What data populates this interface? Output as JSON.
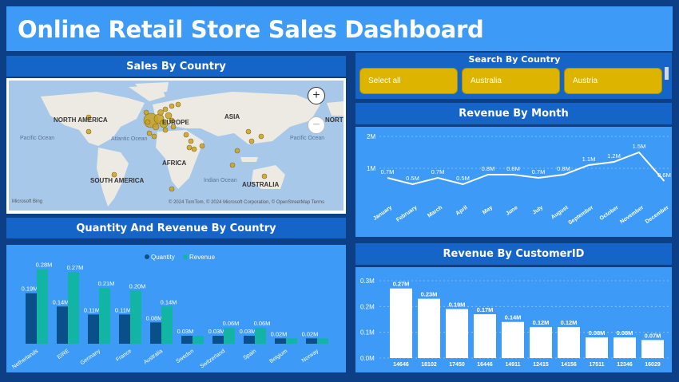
{
  "title": "Online Retail Store Sales Dashboard",
  "panels": {
    "sales_by_country": "Sales By Country",
    "qty_rev_country": "Quantity And Revenue By Country",
    "search_country": "Search By Country",
    "revenue_month": "Revenue By Month",
    "revenue_customer": "Revenue By CustomerID"
  },
  "slicer": {
    "items": [
      "Select all",
      "Australia",
      "Austria"
    ]
  },
  "map": {
    "labels": {
      "north_america": "NORTH AMERICA",
      "europe": "EUROPE",
      "asia": "ASIA",
      "africa": "AFRICA",
      "south_america": "SOUTH AMERICA",
      "australia": "AUSTRALIA",
      "north_cut": "NORTI",
      "pacific_left": "Pacific Ocean",
      "atlantic": "Atlantic Ocean",
      "indian": "Indian Ocean",
      "pacific_right": "Pacific Ocean"
    },
    "zoom_in": "+",
    "zoom_out": "−",
    "copyright": "© 2024 TomTom, © 2024 Microsoft Corporation, © OpenStreetMap  Terms",
    "logo": "Microsoft Bing"
  },
  "colors": {
    "background": "#0d3f86",
    "panel": "#3d9bf7",
    "header": "#1565c8",
    "quantity": "#0b4f8a",
    "revenue": "#12b5a4",
    "slicer": "#ddb400",
    "bubble": "#c9a227"
  },
  "chart_data": [
    {
      "type": "bar",
      "title": "Quantity And Revenue By Country",
      "categories": [
        "Netherlands",
        "EIRE",
        "Germany",
        "France",
        "Australia",
        "Sweden",
        "Switzerland",
        "Spain",
        "Belgium",
        "Norway"
      ],
      "series": [
        {
          "name": "Quantity",
          "values": [
            0.19,
            0.14,
            0.11,
            0.11,
            0.08,
            0.03,
            0.03,
            0.03,
            0.02,
            0.02
          ],
          "labels": [
            "0.19M",
            "0.14M",
            "0.11M",
            "0.11M",
            "0.08M",
            "0.03M",
            "0.03M",
            "0.03M",
            "0.02M",
            "0.02M"
          ]
        },
        {
          "name": "Revenue",
          "values": [
            0.28,
            0.27,
            0.21,
            0.2,
            0.14,
            0.03,
            0.06,
            0.06,
            0.02,
            0.02
          ],
          "labels": [
            "0.28M",
            "0.27M",
            "0.21M",
            "0.20M",
            "0.14M",
            "",
            "0.06M",
            "0.06M",
            "",
            ""
          ]
        }
      ],
      "legend": "top-center"
    },
    {
      "type": "line",
      "title": "Revenue By Month",
      "categories": [
        "January",
        "February",
        "March",
        "April",
        "May",
        "June",
        "July",
        "August",
        "September",
        "October",
        "November",
        "December"
      ],
      "values": [
        0.7,
        0.5,
        0.7,
        0.5,
        0.8,
        0.8,
        0.7,
        0.8,
        1.1,
        1.2,
        1.5,
        0.6
      ],
      "labels": [
        "0.7M",
        "0.5M",
        "0.7M",
        "0.5M",
        "0.8M",
        "0.8M",
        "0.7M",
        "0.8M",
        "1.1M",
        "1.2M",
        "1.5M",
        "0.6M"
      ],
      "yticks": [
        "1M",
        "2M"
      ],
      "ylim": [
        0,
        2
      ]
    },
    {
      "type": "bar",
      "title": "Revenue By CustomerID",
      "categories": [
        "14646",
        "18102",
        "17450",
        "16446",
        "14911",
        "12415",
        "14156",
        "17511",
        "12346",
        "16029"
      ],
      "values": [
        0.27,
        0.23,
        0.19,
        0.17,
        0.14,
        0.12,
        0.12,
        0.08,
        0.08,
        0.07
      ],
      "labels": [
        "0.27M",
        "0.23M",
        "0.19M",
        "0.17M",
        "0.14M",
        "0.12M",
        "0.12M",
        "0.08M",
        "0.08M",
        "0.07M"
      ],
      "yticks": [
        "0.0M",
        "0.1M",
        "0.2M",
        "0.3M"
      ],
      "ylim": [
        0,
        0.3
      ]
    }
  ]
}
